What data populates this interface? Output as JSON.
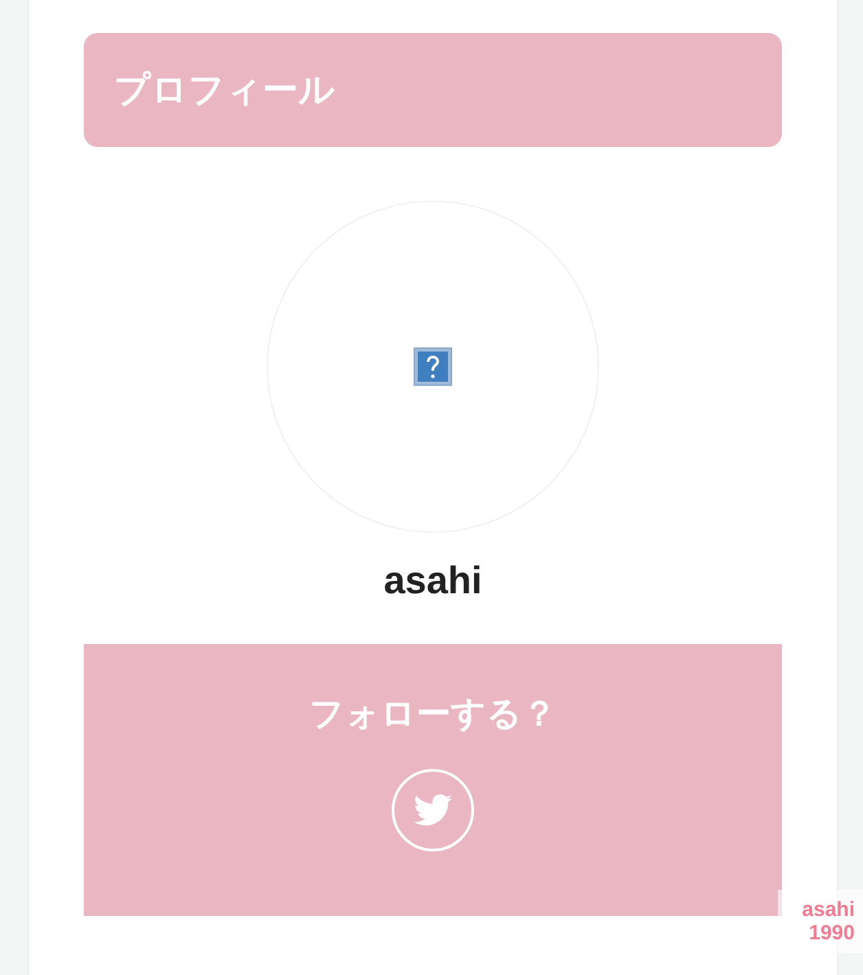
{
  "widget": {
    "title": "プロフィール"
  },
  "profile": {
    "avatar": {
      "kind": "broken-image"
    },
    "name": "asahi"
  },
  "follow": {
    "title": "フォローする？",
    "buttons": [
      {
        "kind": "twitter"
      }
    ]
  },
  "corner_logo": {
    "lines": [
      "asahi",
      "1990"
    ]
  }
}
